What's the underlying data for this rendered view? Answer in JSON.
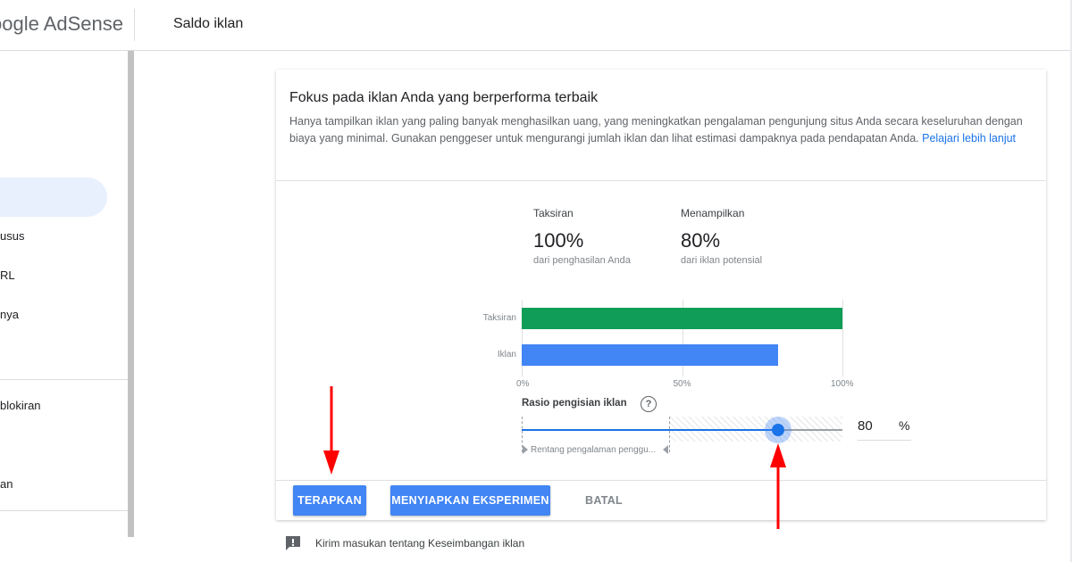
{
  "header": {
    "logo_text": "oogle AdSense",
    "page_title": "Saldo iklan"
  },
  "sidebar": {
    "items": [
      {
        "label": "usus"
      },
      {
        "label": "RL"
      },
      {
        "label": "nya"
      },
      {
        "label": "blokiran"
      },
      {
        "label": "an"
      }
    ]
  },
  "card": {
    "title": "Fokus pada iklan Anda yang berperforma terbaik",
    "description": "Hanya tampilkan iklan yang paling banyak menghasilkan uang, yang meningkatkan pengalaman pengunjung situs Anda secara keseluruhan dengan biaya yang minimal. Gunakan penggeser untuk mengurangi jumlah iklan dan lihat estimasi dampaknya pada pendapatan Anda. ",
    "learn_more": "Pelajari lebih lanjut",
    "stats": [
      {
        "label": "Taksiran",
        "value": "100%",
        "sub": "dari penghasilan Anda"
      },
      {
        "label": "Menampilkan",
        "value": "80%",
        "sub": "dari iklan potensial"
      }
    ]
  },
  "chart_data": {
    "type": "bar",
    "orientation": "horizontal",
    "categories": [
      "Taksiran",
      "Iklan"
    ],
    "values": [
      100,
      80
    ],
    "colors": [
      "#0f9d58",
      "#4285f4"
    ],
    "xlim": [
      0,
      100
    ],
    "ticks": [
      "0%",
      "50%",
      "100%"
    ],
    "grid": true
  },
  "slider": {
    "title": "Rasio pengisian iklan",
    "help_glyph": "?",
    "value": 80,
    "value_text": "80",
    "unit": "%",
    "range_label": "Rentang pengalaman penggu...",
    "range_start_percent": 0,
    "range_end_percent": 46,
    "accent": "#1a73e8"
  },
  "actions": {
    "apply": "TERAPKAN",
    "experiment": "MENYIAPKAN EKSPERIMEN",
    "cancel": "BATAL"
  },
  "feedback": {
    "text": "Kirim masukan tentang Keseimbangan iklan",
    "icon": "feedback-icon"
  },
  "annotations": {
    "arrow_color": "#ff0000"
  }
}
